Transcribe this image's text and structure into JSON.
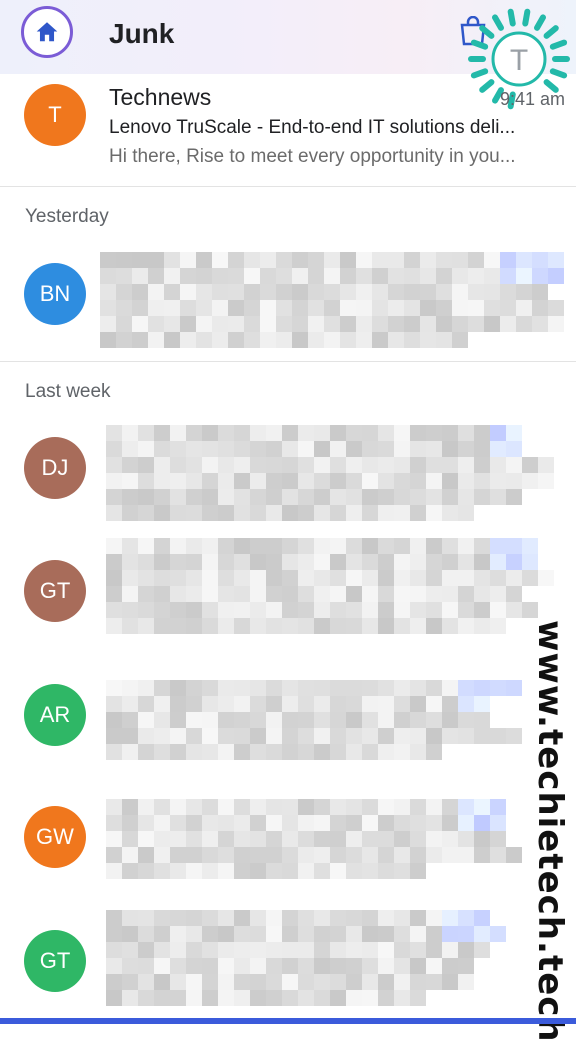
{
  "header": {
    "title": "Junk",
    "home_icon": "home-icon",
    "bag_icon": "shopping-bag-icon",
    "logo_letter": "T",
    "accent": "#7b5cd6"
  },
  "emails_today": [
    {
      "initial": "T",
      "color": "#f0771d",
      "sender": "Technews",
      "subject": "Lenovo TruScale - End-to-end IT solutions deli...",
      "snippet": "Hi there, Rise to meet every opportunity in you...",
      "time": "9:41 am"
    }
  ],
  "sections": [
    {
      "label": "Yesterday",
      "emails": [
        {
          "initials": "BN",
          "color": "#2e8de0"
        }
      ]
    },
    {
      "label": "Last week",
      "emails": [
        {
          "initials": "DJ",
          "color": "#a86c5a"
        },
        {
          "initials": "GT",
          "color": "#a86c5a"
        },
        {
          "initials": "AR",
          "color": "#2fb766"
        },
        {
          "initials": "GW",
          "color": "#f0771d"
        },
        {
          "initials": "GT",
          "color": "#2fb766"
        }
      ]
    }
  ],
  "watermark": "www.techietech.tech"
}
